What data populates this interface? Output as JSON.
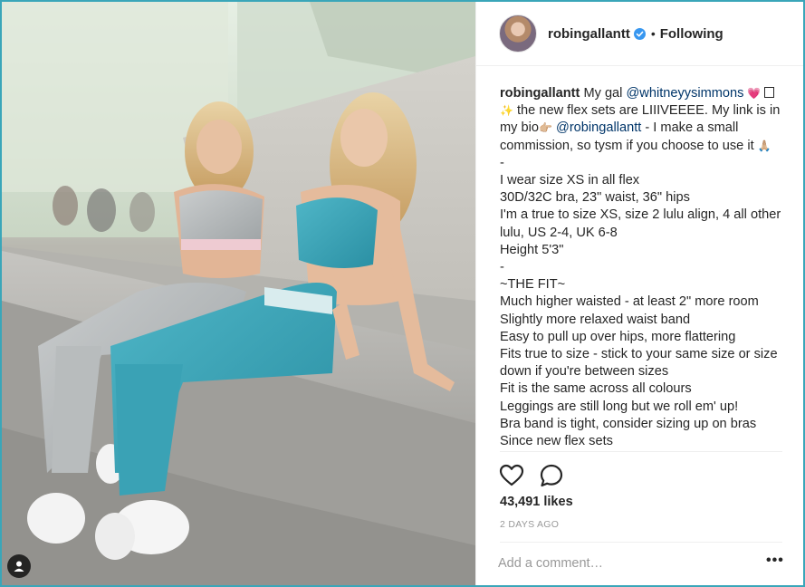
{
  "header": {
    "username": "robingallantt",
    "separator": "•",
    "follow_status": "Following"
  },
  "caption": {
    "author": "robingallantt",
    "lines": [
      {
        "parts": [
          {
            "t": "My gal ",
            "k": "text"
          },
          {
            "t": "@whitneyysimmons",
            "k": "mention"
          },
          {
            "t": " 💗",
            "k": "emoji"
          }
        ]
      },
      {
        "parts": [
          {
            "t": "✨",
            "k": "emoji"
          },
          {
            "t": " the new flex sets are LIIIVEEEE. My link is in my bio",
            "k": "text"
          },
          {
            "t": "👉🏼",
            "k": "emoji"
          },
          {
            "t": " ",
            "k": "text"
          },
          {
            "t": "@robingallantt",
            "k": "mention"
          },
          {
            "t": " - I make a small commission, so tysm if you choose to use it ",
            "k": "text"
          },
          {
            "t": "🙏🏼",
            "k": "emoji"
          }
        ]
      }
    ],
    "body": [
      "-",
      "I wear size XS in all flex",
      "30D/32C bra, 23\" waist, 36\" hips",
      "I'm a true to size XS, size 2 lulu align, 4 all other lulu, US 2-4, UK 6-8",
      "Height 5'3\"",
      "-",
      "~THE FIT~",
      "Much higher waisted - at least 2\" more room",
      "Slightly more relaxed waist band",
      "Easy to pull up over hips, more flattering",
      "Fits true to size - stick to your same size or size down if you're between sizes",
      "Fit is the same across all colours",
      "Leggings are still long but we roll em' up!",
      "Bra band is tight, consider sizing up on bras",
      "Since new flex sets"
    ]
  },
  "icons": {
    "like": "heart-icon",
    "comment": "comment-icon",
    "verified": "verified-badge-icon",
    "user_tag": "user-tag-icon",
    "more": "more-options-icon"
  },
  "likes": "43,491 likes",
  "timestamp": "2 DAYS AGO",
  "comment": {
    "placeholder": "Add a comment…",
    "value": ""
  },
  "more_label": "•••",
  "colors": {
    "frame": "#3aa6b9",
    "verified": "#3897f0",
    "mention": "#003569",
    "muted": "#999999"
  }
}
